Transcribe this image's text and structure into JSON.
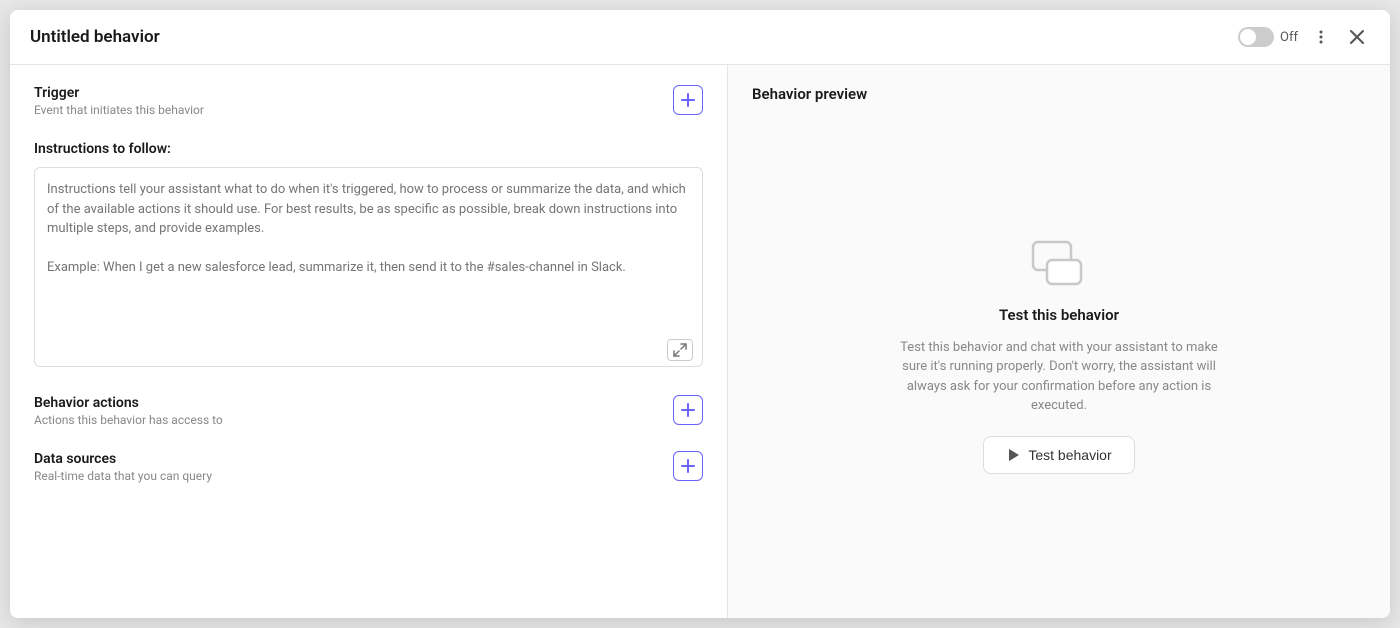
{
  "modal": {
    "title": "Untitled behavior",
    "toggle_label": "Off",
    "more_icon": "more-vertical-icon",
    "close_icon": "close-icon"
  },
  "left_panel": {
    "trigger_section": {
      "title": "Trigger",
      "subtitle": "Event that initiates this behavior",
      "add_icon": "plus-icon"
    },
    "instructions_section": {
      "label": "Instructions to follow:",
      "placeholder_line1": "Instructions tell your assistant what to do when it's triggered, how to process or summarize the data, and",
      "placeholder_line2": "which of the available actions it should use. For best results, be as specific as possible, break down",
      "placeholder_line3": "instructions into multiple steps, and provide examples.",
      "placeholder_line4": "",
      "placeholder_line5": "Example: When I get a new salesforce lead, summarize it, then send it to the #sales-channel in Slack.",
      "expand_icon": "expand-icon"
    },
    "behavior_actions_section": {
      "title": "Behavior actions",
      "subtitle": "Actions this behavior has access to",
      "add_icon": "plus-icon"
    },
    "data_sources_section": {
      "title": "Data sources",
      "subtitle": "Real-time data that you can query",
      "add_icon": "plus-icon"
    }
  },
  "right_panel": {
    "title": "Behavior preview",
    "chat_icon": "chat-bubbles-icon",
    "preview_title": "Test this behavior",
    "preview_description": "Test this behavior and chat with your assistant to make sure it's running properly. Don't worry, the assistant will always ask for your confirmation before any action is executed.",
    "test_button_label": "Test behavior",
    "play_icon": "play-icon"
  }
}
